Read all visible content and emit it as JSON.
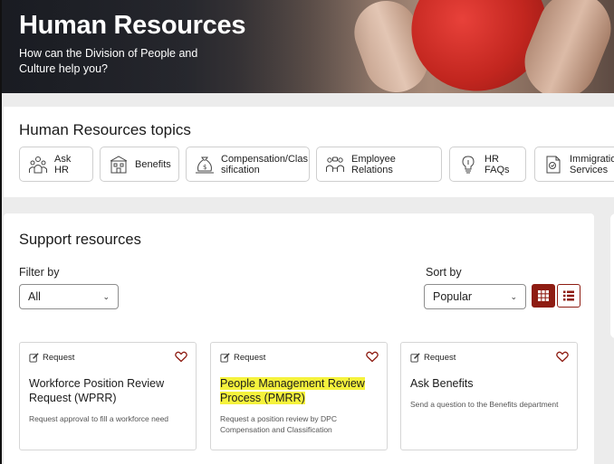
{
  "hero": {
    "title": "Human Resources",
    "subtitle": "How can the Division of People and Culture help you?"
  },
  "topics": {
    "heading": "Human Resources topics",
    "items": [
      {
        "label": "Ask HR",
        "icon": "people-group-icon"
      },
      {
        "label": "Benefits",
        "icon": "building-icon"
      },
      {
        "label": "Compensation/Clas sification",
        "icon": "money-bag-icon"
      },
      {
        "label": "Employee Relations",
        "icon": "people-relations-icon"
      },
      {
        "label": "HR FAQs",
        "icon": "lightbulb-icon"
      },
      {
        "label": "Immigration Services",
        "icon": "document-check-icon"
      }
    ]
  },
  "support": {
    "heading": "Support resources",
    "filter_label": "Filter by",
    "filter_value": "All",
    "sort_label": "Sort by",
    "sort_value": "Popular",
    "cards": [
      {
        "tag": "Request",
        "title": "Workforce Position Review Request (WPRR)",
        "desc": "Request approval to fill a workforce need",
        "highlighted": false
      },
      {
        "tag": "Request",
        "title": "People Management Review Process (PMRR)",
        "desc": "Request a position review by DPC Compensation and Classification",
        "highlighted": true
      },
      {
        "tag": "Request",
        "title": "Ask Benefits",
        "desc": "Send a question to the Benefits department",
        "highlighted": false
      }
    ]
  },
  "colors": {
    "accent": "#8e1c12",
    "highlight": "#f5f23c"
  }
}
